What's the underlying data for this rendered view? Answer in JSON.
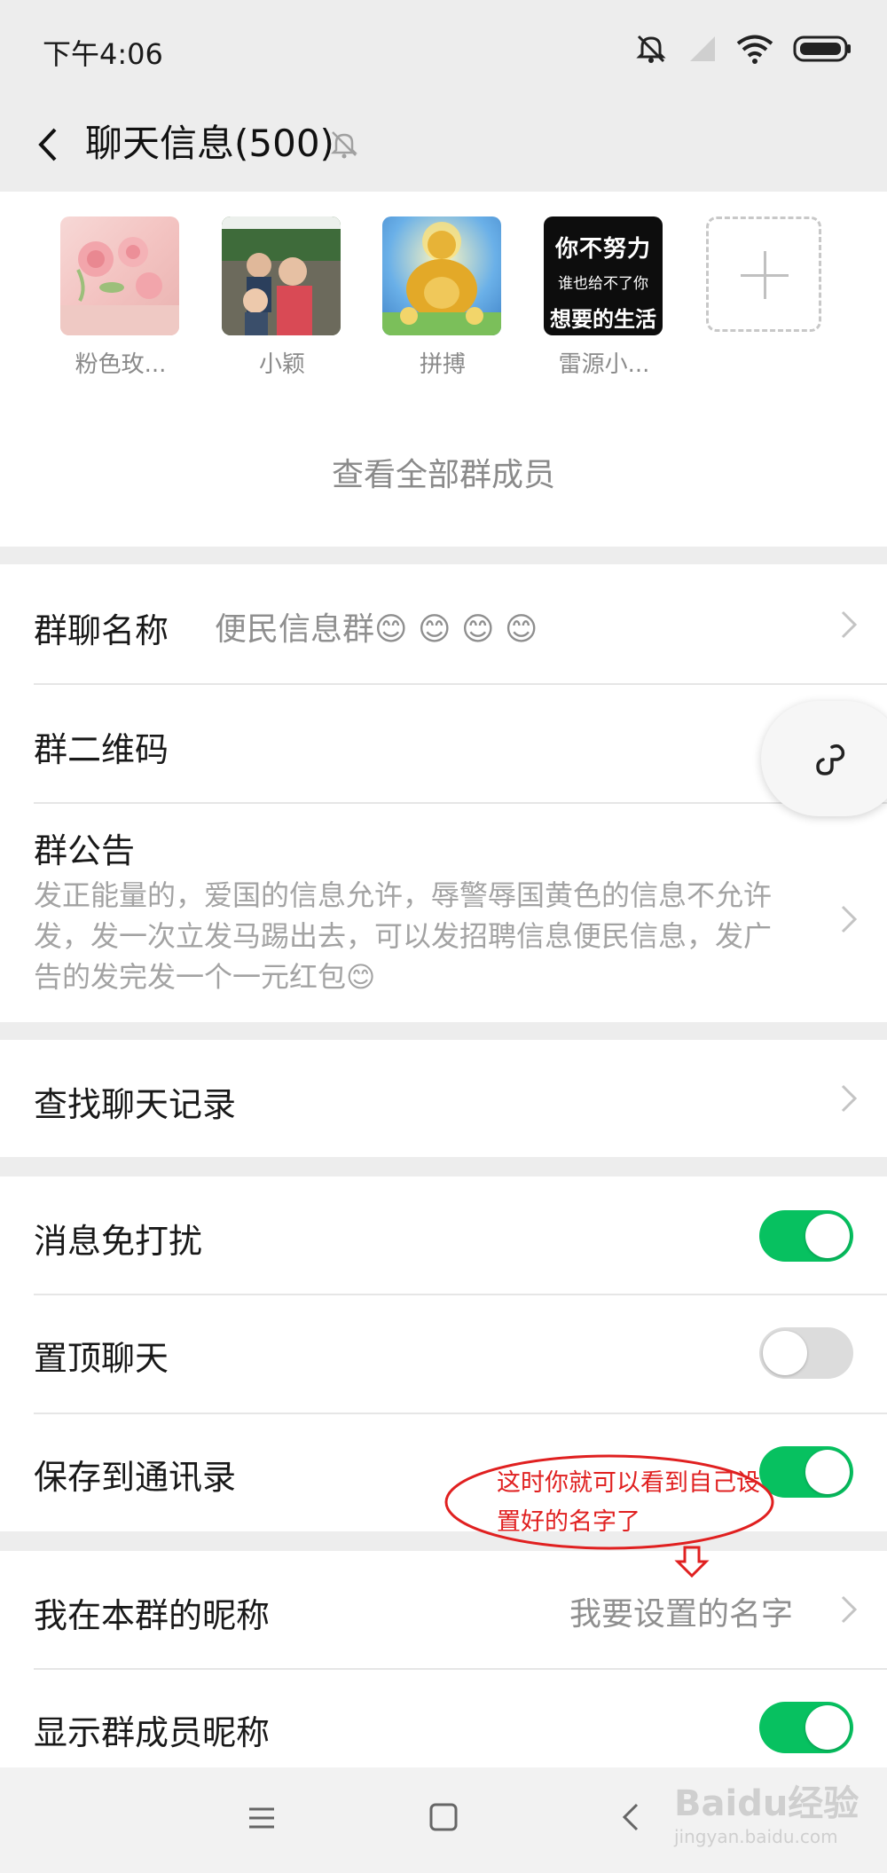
{
  "status_bar": {
    "time": "下午4:06"
  },
  "header": {
    "title": "聊天信息(500)"
  },
  "members": [
    {
      "name": "粉色玫..."
    },
    {
      "name": "小颖"
    },
    {
      "name": "拼搏"
    },
    {
      "name": "雷源小...",
      "avatar_text_line1": "你不努力",
      "avatar_text_line2": "谁也给不了你",
      "avatar_text_line3": "想要的生活"
    }
  ],
  "view_all_members": "查看全部群成员",
  "group_info": {
    "name_label": "群聊名称",
    "name_value": "便民信息群😊 😊 😊 😊",
    "qrcode_label": "群二维码",
    "notice_label": "群公告",
    "notice_text": "发正能量的，爱国的信息允许，辱警辱国黄色的信息不允许发，发一次立发马踢出去，可以发招聘信息便民信息，发广告的发完发一个一元红包😊"
  },
  "search_history": "查找聊天记录",
  "settings": {
    "mute_label": "消息免打扰",
    "mute_on": true,
    "pin_label": "置顶聊天",
    "pin_on": false,
    "save_contacts_label": "保存到通讯录",
    "save_contacts_on": true
  },
  "nickname": {
    "my_nickname_label": "我在本群的昵称",
    "my_nickname_value": "我要设置的名字",
    "show_nicknames_label": "显示群成员昵称",
    "show_nicknames_on": true
  },
  "annotation": {
    "text": "这时你就可以看到自己设置好的名字了"
  },
  "watermark": {
    "brand": "Baidu经验",
    "url": "jingyan.baidu.com"
  },
  "colors": {
    "toggle_on": "#07c160",
    "background": "#ededed",
    "annotation": "#e02020"
  },
  "icons": [
    "mute-icon",
    "signal-icon",
    "wifi-icon",
    "battery-icon",
    "back-arrow-icon",
    "bell-off-icon",
    "add-member-icon",
    "chevron-right-icon",
    "mini-program-link-icon",
    "menu-icon",
    "home-icon",
    "back-nav-icon"
  ]
}
